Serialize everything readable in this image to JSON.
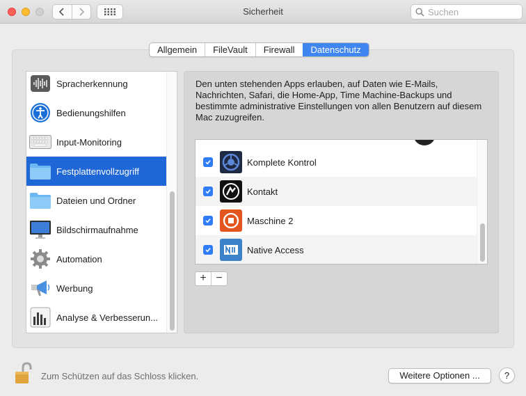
{
  "window": {
    "title": "Sicherheit"
  },
  "search": {
    "placeholder": "Suchen"
  },
  "tabs": [
    {
      "label": "Allgemein"
    },
    {
      "label": "FileVault"
    },
    {
      "label": "Firewall"
    },
    {
      "label": "Datenschutz",
      "active": true
    }
  ],
  "sidebar": {
    "items": [
      {
        "label": "Spracherkennung",
        "icon": "speech-recognition-icon"
      },
      {
        "label": "Bedienungshilfen",
        "icon": "accessibility-icon"
      },
      {
        "label": "Input-Monitoring",
        "icon": "keyboard-icon"
      },
      {
        "label": "Festplattenvollzugriff",
        "icon": "folder-icon",
        "selected": true
      },
      {
        "label": "Dateien und Ordner",
        "icon": "folder-icon"
      },
      {
        "label": "Bildschirmaufnahme",
        "icon": "display-icon"
      },
      {
        "label": "Automation",
        "icon": "gear-icon"
      },
      {
        "label": "Werbung",
        "icon": "megaphone-icon"
      },
      {
        "label": "Analyse & Verbesserun...",
        "icon": "analytics-icon"
      }
    ]
  },
  "content": {
    "description": "Den unten stehenden Apps erlauben, auf Daten wie E-Mails, Nachrichten, Safari, die Home-App, Time Machine-Backups und bestimmte administrative Einstellungen von allen Benutzern auf diesem Mac zuzugreifen.",
    "apps": [
      {
        "label": "Komplete Kontrol",
        "checked": true,
        "icon": "komplete-kontrol-icon"
      },
      {
        "label": "Kontakt",
        "checked": true,
        "icon": "kontakt-icon"
      },
      {
        "label": "Maschine 2",
        "checked": true,
        "icon": "maschine-icon"
      },
      {
        "label": "Native Access",
        "checked": true,
        "icon": "native-access-icon"
      }
    ],
    "add_label": "+",
    "remove_label": "−"
  },
  "footer": {
    "lock_text": "Zum Schützen auf das Schloss klicken.",
    "more_options": "Weitere Optionen ...",
    "help": "?"
  },
  "colors": {
    "accent": "#3f86f0",
    "selection": "#1f67d6",
    "checkbox": "#2f7cf6"
  }
}
